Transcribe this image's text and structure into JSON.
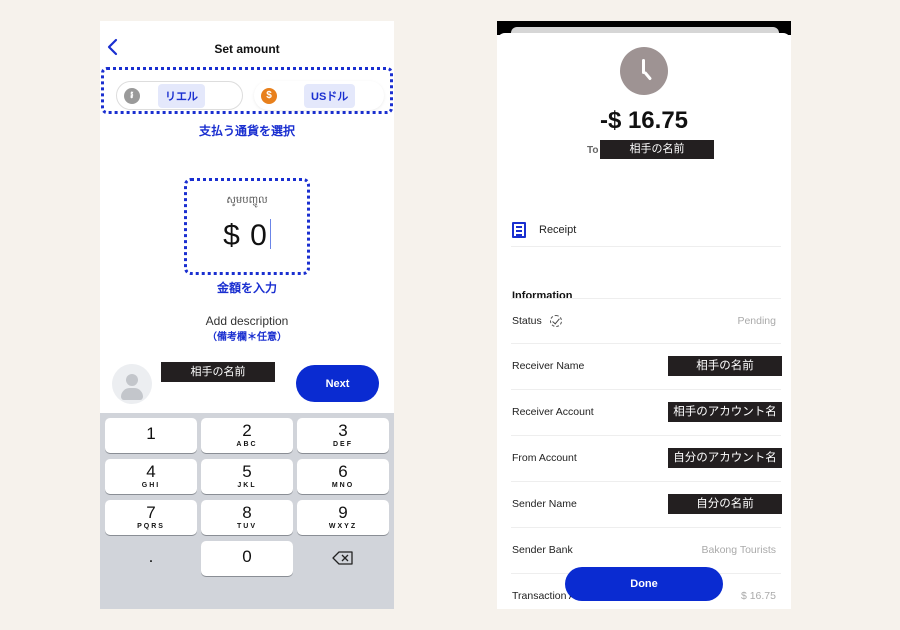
{
  "left": {
    "header": {
      "title": "Set amount",
      "back_icon": "chevron-left-icon"
    },
    "currencies": [
      {
        "label": "リエル",
        "icon": "riel-coin-icon",
        "color": "#9a9a9a",
        "symbol": "៛"
      },
      {
        "label": "USドル",
        "icon": "dollar-coin-icon",
        "color": "#e8801c",
        "symbol": "$"
      }
    ],
    "annotation_currency": "支払う通貨を選択",
    "amount_label": "សូមបញ្ចូល",
    "amount_value": "$ 0",
    "annotation_amount": "金額を入力",
    "description_link": "Add description",
    "annotation_description": "（備考欄＊任意）",
    "recipient_name": "相手の名前",
    "next_label": "Next",
    "keypad": [
      {
        "digit": "1",
        "letters": ""
      },
      {
        "digit": "2",
        "letters": "ABC"
      },
      {
        "digit": "3",
        "letters": "DEF"
      },
      {
        "digit": "4",
        "letters": "GHI"
      },
      {
        "digit": "5",
        "letters": "JKL"
      },
      {
        "digit": "6",
        "letters": "MNO"
      },
      {
        "digit": "7",
        "letters": "PQRS"
      },
      {
        "digit": "8",
        "letters": "TUV"
      },
      {
        "digit": "9",
        "letters": "WXYZ"
      },
      {
        "digit": ".",
        "letters": ""
      },
      {
        "digit": "0",
        "letters": ""
      },
      {
        "digit": "⌫",
        "letters": ""
      }
    ]
  },
  "right": {
    "status_icon": "clock-icon",
    "amount": "-$ 16.75",
    "to_label": "To",
    "to_name": "相手の名前",
    "receipt_label": "Receipt",
    "info_header": "Information",
    "rows": [
      {
        "key": "Status",
        "value": "Pending",
        "redacted": false
      },
      {
        "key": "Receiver Name",
        "value": "相手の名前",
        "redacted": true
      },
      {
        "key": "Receiver Account",
        "value": "相手のアカウント名",
        "redacted": true
      },
      {
        "key": "From Account",
        "value": "自分のアカウント名",
        "redacted": true
      },
      {
        "key": "Sender Name",
        "value": "自分の名前",
        "redacted": true
      },
      {
        "key": "Sender Bank",
        "value": "Bakong Tourists",
        "redacted": false
      },
      {
        "key": "Transaction Amount",
        "value": "$ 16.75",
        "redacted": false
      }
    ],
    "done_label": "Done"
  },
  "colors": {
    "accent": "#0a2bd1",
    "annotation": "#1a2fd0",
    "redaction": "#231f20",
    "background": "#f6f2ec"
  }
}
